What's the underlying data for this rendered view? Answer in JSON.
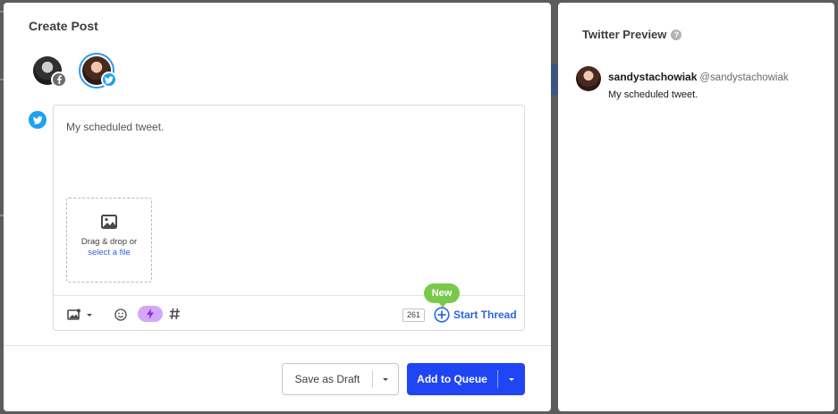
{
  "composer": {
    "title": "Create Post",
    "post_text": "My scheduled tweet.",
    "dropzone": {
      "text": "Drag & drop or",
      "link": "select a file"
    },
    "toolbar": {
      "char_count": "261",
      "start_thread_label": "Start Thread",
      "new_badge": "New"
    },
    "buttons": {
      "draft_label": "Save as Draft",
      "queue_label": "Add to Queue"
    },
    "colors": {
      "primary": "#1f45f5",
      "twitter": "#1da1f2",
      "new_badge": "#7bc94c",
      "link": "#2c66e0"
    }
  },
  "preview": {
    "title": "Twitter Preview",
    "help_glyph": "?",
    "display_name": "sandystachowiak",
    "handle": "@sandystachowiak",
    "text": "My scheduled tweet."
  }
}
